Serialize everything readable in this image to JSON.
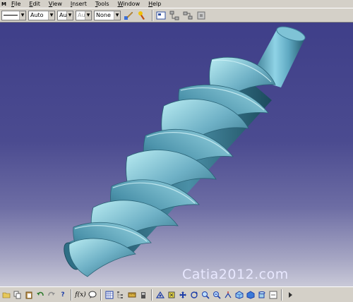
{
  "menubar": {
    "items": [
      {
        "label": "File",
        "accel": "F"
      },
      {
        "label": "Edit",
        "accel": "E"
      },
      {
        "label": "View",
        "accel": "V"
      },
      {
        "label": "Insert",
        "accel": "I"
      },
      {
        "label": "Tools",
        "accel": "T"
      },
      {
        "label": "Window",
        "accel": "W"
      },
      {
        "label": "Help",
        "accel": "H"
      }
    ]
  },
  "toolbar": {
    "line_type": "",
    "color_value": "Auto",
    "thickness_value": "Aut",
    "layer_value": "Aut",
    "layer_disabled": true,
    "mode_value": "None",
    "icons": [
      "paint-brush-icon",
      "format-painter-icon",
      "snapshot-icon",
      "parent-children-icon",
      "links-icon",
      "component-icon"
    ]
  },
  "viewport": {
    "watermark": "Catia2012.com",
    "background_top": "#3f3f89",
    "background_bottom": "#c9c9d8",
    "model_color": "#6fb1c6"
  },
  "bottombar": {
    "formula_label": "f(x)",
    "icons": [
      "folder-open-icon",
      "copy-icon",
      "paste-icon",
      "undo-icon",
      "redo-icon",
      "help-icon",
      "formula-icon",
      "knowledge-icon",
      "table-icon",
      "tree-icon",
      "measure-icon",
      "inertia-icon",
      "fly-icon",
      "fit-all-icon",
      "pan-icon",
      "rotate-icon",
      "zoom-in-icon",
      "zoom-out-icon",
      "normal-view-icon",
      "isometric-view-icon",
      "shading-icon",
      "hide-show-icon",
      "swap-visible-icon",
      "scroll-right-icon"
    ]
  }
}
